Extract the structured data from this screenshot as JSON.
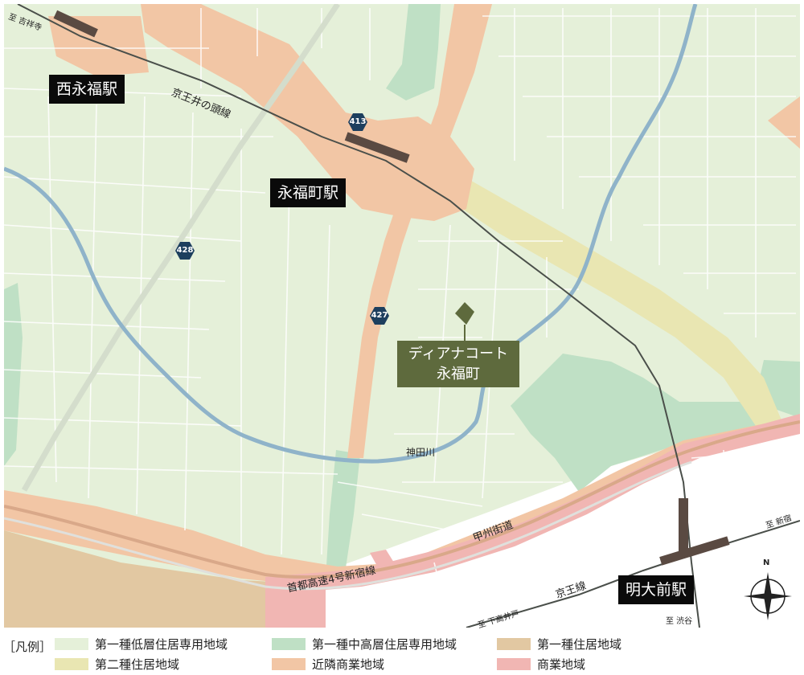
{
  "colors": {
    "low_rise_residential": "#e5f0d9",
    "mid_high_residential": "#bfe0c5",
    "residential_1": "#e2c8a2",
    "residential_2": "#e9e6b2",
    "neighborhood_commercial": "#f2c6a5",
    "commercial": "#f1b6b3",
    "river": "#8fb3c9",
    "rail": "#4a4f4a",
    "station_platform": "#5a4a42",
    "property": "#5e6a3d"
  },
  "stations": {
    "nishi_eifuku": "西永福駅",
    "eifukucho": "永福町駅",
    "meidaimae": "明大前駅"
  },
  "property": {
    "line1": "ディアナコート",
    "line2": "永福町"
  },
  "route_numbers": {
    "r413": "413",
    "r428": "428",
    "r427": "427"
  },
  "map_labels": {
    "keio_inokashira_line": "京王井の頭線",
    "kanda_river": "神田川",
    "koshu_kaido": "甲州街道",
    "shuto_expressway": "首都高速4号新宿線",
    "keio_line": "京王線",
    "to_kichijoji": "至 吉祥寺",
    "to_shinjuku": "至 新宿",
    "to_shimotakaido": "至 下高井戸",
    "to_shibuya": "至 渋谷"
  },
  "compass": {
    "north_label": "N",
    "icon": "compass-rose-icon"
  },
  "legend": {
    "title": "［凡例］",
    "items": [
      {
        "label": "第一種低層住居専用地域",
        "color_key": "low_rise_residential"
      },
      {
        "label": "第一種中高層住居専用地域",
        "color_key": "mid_high_residential"
      },
      {
        "label": "第一種住居地域",
        "color_key": "residential_1"
      },
      {
        "label": "第二種住居地域",
        "color_key": "residential_2"
      },
      {
        "label": "近隣商業地域",
        "color_key": "neighborhood_commercial"
      },
      {
        "label": "商業地域",
        "color_key": "commercial"
      }
    ]
  }
}
